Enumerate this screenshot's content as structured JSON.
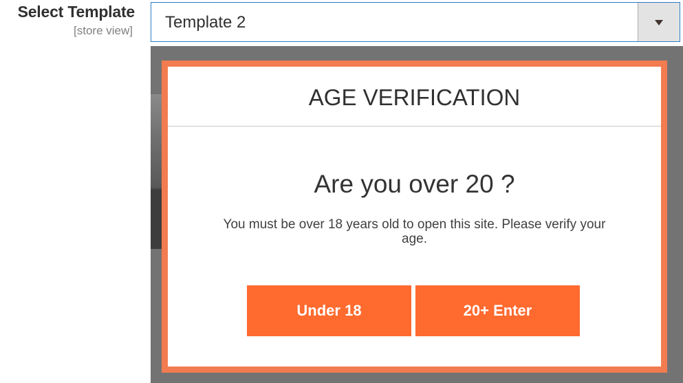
{
  "field": {
    "label": "Select Template",
    "scope": "[store view]",
    "selected_value": "Template 2"
  },
  "popup": {
    "title": "AGE VERIFICATION",
    "question": "Are you over 20 ?",
    "message": "You must be over 18 years old to open this site. Please verify your age.",
    "buttons": {
      "under_label": "Under 18",
      "enter_label": "20+ Enter"
    }
  },
  "colors": {
    "accent_button": "#ff6a2f",
    "popup_border": "#f27c50",
    "select_focus_border": "#2e7cc8",
    "overlay": "#737373"
  },
  "icons": {
    "select_arrow": "chevron-down-icon"
  }
}
